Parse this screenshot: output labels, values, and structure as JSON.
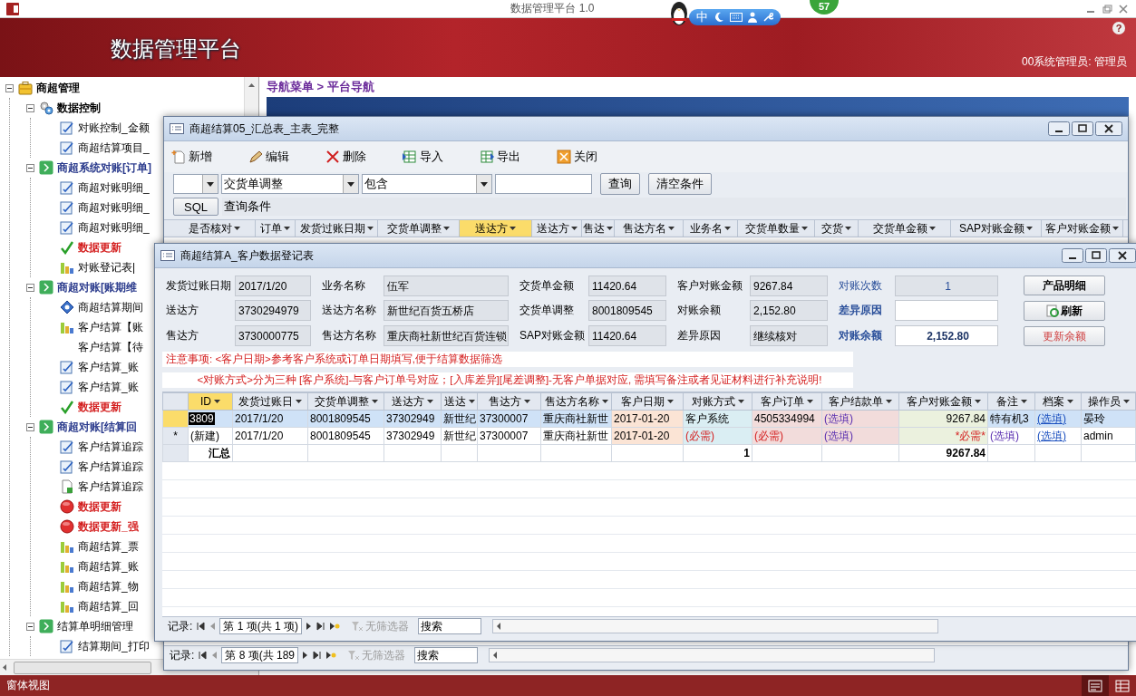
{
  "app_title": "数据管理平台 1.0",
  "header": {
    "title": "数据管理平台",
    "user": "00系统管理员: 管理员",
    "help": "?"
  },
  "ime_toolbar": {
    "label": "中",
    "badge": "57"
  },
  "tree": [
    {
      "label": "商超管理",
      "kind": "root",
      "expanded": true,
      "children": [
        {
          "label": "数据控制",
          "kind": "control",
          "expanded": true,
          "children": [
            {
              "label": "对账控制_金额",
              "kind": "form"
            },
            {
              "label": "商超结算项目_",
              "kind": "form"
            }
          ]
        },
        {
          "label": "商超系统对账[订单]",
          "kind": "section",
          "expanded": true,
          "children": [
            {
              "label": "商超对账明细_",
              "kind": "form"
            },
            {
              "label": "商超对账明细_",
              "kind": "form"
            },
            {
              "label": "商超对账明细_",
              "kind": "form"
            },
            {
              "label": "数据更新",
              "kind": "update"
            },
            {
              "label": "对账登记表|",
              "kind": "chart"
            }
          ]
        },
        {
          "label": "商超对账[账期维",
          "kind": "section",
          "expanded": true,
          "children": [
            {
              "label": "商超结算期间",
              "kind": "period"
            },
            {
              "label": "客户结算【账",
              "kind": "chart"
            },
            {
              "label": "客户结算【待",
              "kind": "blank"
            },
            {
              "label": "客户结算_账",
              "kind": "form"
            },
            {
              "label": "客户结算_账",
              "kind": "form"
            },
            {
              "label": "数据更新",
              "kind": "update"
            }
          ]
        },
        {
          "label": "商超对账[结算回",
          "kind": "section",
          "expanded": true,
          "children": [
            {
              "label": "客户结算追踪",
              "kind": "form"
            },
            {
              "label": "客户结算追踪",
              "kind": "form"
            },
            {
              "label": "客户结算追踪",
              "kind": "doc"
            },
            {
              "label": "数据更新",
              "kind": "stop"
            },
            {
              "label": "数据更新_强",
              "kind": "stop"
            },
            {
              "label": "商超结算_票",
              "kind": "chart"
            },
            {
              "label": "商超结算_账",
              "kind": "chart"
            },
            {
              "label": "商超结算_物",
              "kind": "chart"
            },
            {
              "label": "商超结算_回",
              "kind": "chart"
            }
          ]
        },
        {
          "label": "结算单明细管理",
          "kind": "section_plain",
          "expanded": true,
          "children": [
            {
              "label": "结算期间_打印",
              "kind": "form"
            }
          ]
        }
      ]
    }
  ],
  "breadcrumb": "导航菜单 > 平台导航",
  "main_window": {
    "title": "商超结算05_汇总表_主表_完整",
    "toolbar": [
      {
        "label": "新增",
        "kind": "new"
      },
      {
        "label": "编辑",
        "kind": "edit"
      },
      {
        "label": "删除",
        "kind": "delete"
      },
      {
        "label": "导入",
        "kind": "import"
      },
      {
        "label": "导出",
        "kind": "export"
      },
      {
        "label": "关闭",
        "kind": "close"
      }
    ],
    "filter": {
      "column": "交货单调整",
      "operator": "包含",
      "buttons": [
        "查询",
        "清空条件"
      ]
    },
    "sql": {
      "button": "SQL",
      "value": "查询条件"
    },
    "columns": [
      {
        "label": "是否核对",
        "selected": false
      },
      {
        "label": "订单",
        "selected": false
      },
      {
        "label": "发货过账日期",
        "selected": false
      },
      {
        "label": "交货单调整",
        "selected": false
      },
      {
        "label": "送达方",
        "selected": true
      },
      {
        "label": "送达方",
        "selected": false
      },
      {
        "label": "售达",
        "selected": false
      },
      {
        "label": "售达方名",
        "selected": false
      },
      {
        "label": "业务名",
        "selected": false
      },
      {
        "label": "交货单数量",
        "selected": false
      },
      {
        "label": "交货",
        "selected": false
      },
      {
        "label": "交货单金额",
        "selected": false
      },
      {
        "label": "SAP对账金额",
        "selected": false
      },
      {
        "label": "客户对账金额",
        "selected": false
      }
    ],
    "record_nav": {
      "label": "记录:",
      "position": "第 8 项(共 189",
      "filter": "无筛选器",
      "search": "搜索"
    }
  },
  "detail_window": {
    "title": "商超结算A_客户数据登记表",
    "fields": [
      {
        "label": "发货过账日期",
        "value": "2017/1/20",
        "kind": "readonly"
      },
      {
        "label": "业务名称",
        "value": "伍军",
        "kind": "readonly"
      },
      {
        "label": "交货单金额",
        "value": "11420.64",
        "kind": "readonly"
      },
      {
        "label": "客户对账金额",
        "value": "9267.84",
        "kind": "readonly"
      },
      {
        "label": "对账次数",
        "value": "1",
        "kind": "count"
      },
      {
        "label": "送达方",
        "value": "3730294979",
        "kind": "readonly"
      },
      {
        "label": "送达方名称",
        "value": "新世纪百货五桥店",
        "kind": "readonly"
      },
      {
        "label": "交货单调整",
        "value": "8001809545",
        "kind": "readonly"
      },
      {
        "label": "对账余额",
        "value": "2,152.80",
        "kind": "readonly"
      },
      {
        "label": "差异原因",
        "kind": "input"
      },
      {
        "label": "售达方",
        "value": "3730000775",
        "kind": "readonly"
      },
      {
        "label": "售达方名称",
        "value": "重庆商社新世纪百货连锁",
        "kind": "readonly"
      },
      {
        "label": "SAP对账金额",
        "value": "11420.64",
        "kind": "readonly"
      },
      {
        "label": "差异原因",
        "value": "继续核对",
        "kind": "readonly"
      },
      {
        "label": "对账余额",
        "value": "2,152.80",
        "kind": "total"
      }
    ],
    "buttons": [
      {
        "label": "产品明细",
        "kind": "plain"
      },
      {
        "label": "刷新",
        "kind": "refresh"
      },
      {
        "label": "更新余额",
        "kind": "warning"
      }
    ],
    "notes": [
      "注意事项: <客户日期>参考客户系统或订单日期填写,便于结算数据筛选",
      "<对账方式>分为三种 [客户系统]-与客户订单号对应；[入库差异][尾差调整]-无客户单据对应, 需填写备注或者见证材料进行补充说明!"
    ],
    "grid": {
      "columns": [
        {
          "label": "ID",
          "selected": true,
          "total": "汇总"
        },
        {
          "label": "发货过账日",
          "selected": false
        },
        {
          "label": "交货单调整",
          "selected": false
        },
        {
          "label": "送达方",
          "selected": false
        },
        {
          "label": "送达",
          "selected": false
        },
        {
          "label": "售达方",
          "selected": false
        },
        {
          "label": "售达方名称",
          "selected": false
        },
        {
          "label": "客户日期",
          "selected": false,
          "color": "#fbe4d5"
        },
        {
          "label": "对账方式",
          "selected": false,
          "color": "#daeef3",
          "total": "1"
        },
        {
          "label": "客户订单",
          "selected": false,
          "color": "#f2dcdb"
        },
        {
          "label": "客户结款单",
          "selected": false,
          "color": "#f2dcdb"
        },
        {
          "label": "客户对账金额",
          "selected": false,
          "color": "#ebf1de",
          "total": "9267.84"
        },
        {
          "label": "备注",
          "selected": false
        },
        {
          "label": "档案",
          "selected": false
        },
        {
          "label": "操作员",
          "selected": false
        }
      ],
      "rows": [
        {
          "selected": true,
          "cells": [
            {
              "text": "3809",
              "kind": "focused"
            },
            {
              "text": "2017/1/20",
              "kind": "text"
            },
            {
              "text": "8001809545",
              "kind": "text"
            },
            {
              "text": "37302949",
              "kind": "text"
            },
            {
              "text": "新世纪",
              "kind": "text"
            },
            {
              "text": "37300007",
              "kind": "text"
            },
            {
              "text": "重庆商社新世",
              "kind": "text"
            },
            {
              "text": "2017-01-20",
              "kind": "text"
            },
            {
              "text": "客户系统",
              "kind": "text"
            },
            {
              "text": "4505334994",
              "kind": "text"
            },
            {
              "text": "(选填)",
              "kind": "hint"
            },
            {
              "text": "9267.84",
              "kind": "number"
            },
            {
              "text": "特有机3",
              "kind": "text"
            },
            {
              "text": "(选填)",
              "kind": "link"
            },
            {
              "text": "晏玲",
              "kind": "text"
            }
          ]
        },
        {
          "selected": false,
          "marker": "*",
          "cells": [
            {
              "text": "(新建)",
              "kind": "text"
            },
            {
              "text": "2017/1/20",
              "kind": "text"
            },
            {
              "text": "8001809545",
              "kind": "text"
            },
            {
              "text": "37302949",
              "kind": "text"
            },
            {
              "text": "新世纪",
              "kind": "text"
            },
            {
              "text": "37300007",
              "kind": "text"
            },
            {
              "text": "重庆商社新世",
              "kind": "text"
            },
            {
              "text": "2017-01-20",
              "kind": "text"
            },
            {
              "text": "(必需)",
              "kind": "required"
            },
            {
              "text": "(必需)",
              "kind": "required"
            },
            {
              "text": "(选填)",
              "kind": "hint"
            },
            {
              "text": "*必需*",
              "kind": "required_number"
            },
            {
              "text": "(选填)",
              "kind": "hint"
            },
            {
              "text": "(选填)",
              "kind": "link"
            },
            {
              "text": "admin",
              "kind": "text"
            }
          ]
        }
      ]
    },
    "record_nav": {
      "label": "记录:",
      "position": "第 1 项(共 1 项)",
      "filter": "无筛选器",
      "search": "搜索"
    }
  },
  "status_bar": {
    "text": "窗体视图",
    "views": [
      {
        "kind": "form",
        "selected": true
      },
      {
        "kind": "datasheet",
        "selected": false
      }
    ]
  }
}
